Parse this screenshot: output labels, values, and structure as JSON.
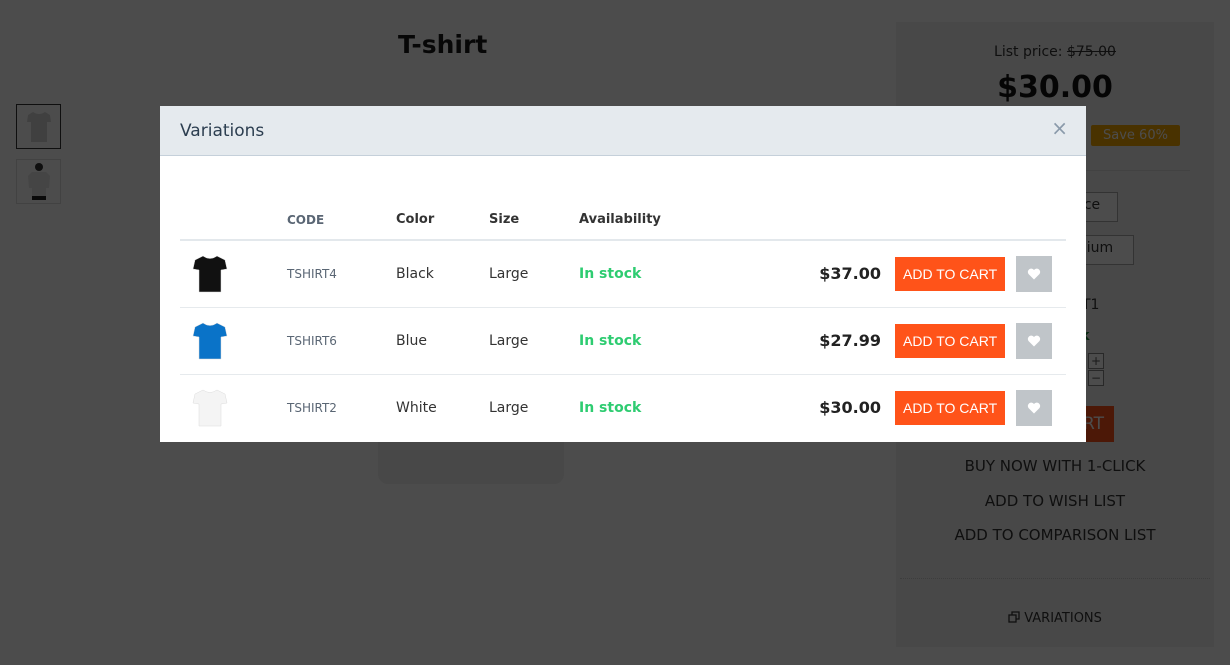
{
  "page": {
    "product_title": "T-shirt",
    "list_price_label": "List price:",
    "list_price_value": "$75.00",
    "price": "$30.00",
    "save_badge": "Save 60%",
    "select1_value": "ce",
    "select2_value": "ium",
    "sku_partial": "T1",
    "stock_partial": "ck",
    "qty_plus": "+",
    "qty_minus": "−",
    "add_to_cart_partial": "RT",
    "buy_now": "BUY NOW WITH 1-CLICK",
    "add_wish": "ADD TO WISH LIST",
    "add_compare": "ADD TO COMPARISON LIST",
    "variations_link": "VARIATIONS"
  },
  "modal": {
    "title": "Variations",
    "close": "×",
    "columns": [
      "",
      "CODE",
      "Color",
      "Size",
      "Availability",
      "",
      "",
      ""
    ],
    "rows": [
      {
        "shirt_color": "#111111",
        "code": "TSHIRT4",
        "color": "Black",
        "size": "Large",
        "availability": "In stock",
        "price": "$37.00",
        "cart_label": "ADD TO CART"
      },
      {
        "shirt_color": "#0a73c8",
        "code": "TSHIRT6",
        "color": "Blue",
        "size": "Large",
        "availability": "In stock",
        "price": "$27.99",
        "cart_label": "ADD TO CART"
      },
      {
        "shirt_color": "#f4f4f4",
        "code": "TSHIRT2",
        "color": "White",
        "size": "Large",
        "availability": "In stock",
        "price": "$30.00",
        "cart_label": "ADD TO CART"
      }
    ]
  },
  "colors": {
    "accent": "#ff5319",
    "in_stock": "#2ecc71",
    "save_badge": "#f5a800",
    "wishlist_button": "#c0c5c9"
  }
}
